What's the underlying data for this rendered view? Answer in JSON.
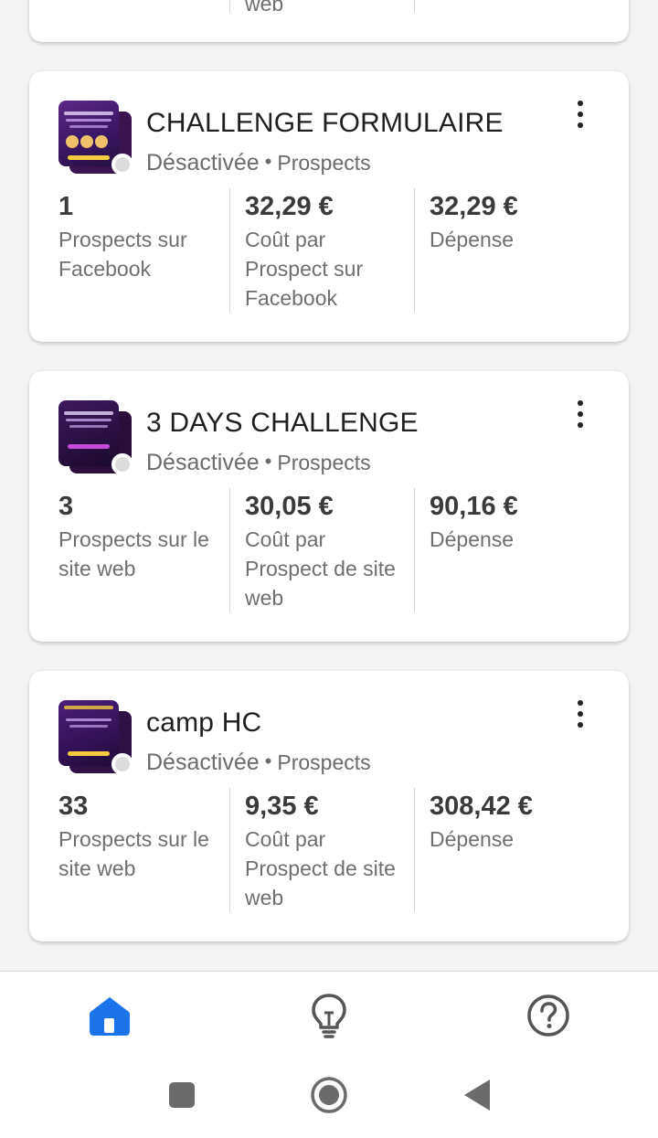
{
  "previous_card": {
    "partial_label": "web"
  },
  "campaigns": [
    {
      "name": "CHALLENGE FORMULAIRE",
      "status": "Désactivée",
      "separator": "•",
      "objective": "Prospects",
      "metrics": [
        {
          "value": "1",
          "label_lines": [
            "Prospects sur",
            "Facebook"
          ]
        },
        {
          "value": "32,29 €",
          "label_lines": [
            "Coût par",
            "Prospect sur",
            "Facebook"
          ]
        },
        {
          "value": "32,29 €",
          "label_lines": [
            "Dépense"
          ]
        }
      ]
    },
    {
      "name": "3 DAYS CHALLENGE",
      "status": "Désactivée",
      "separator": "•",
      "objective": "Prospects",
      "metrics": [
        {
          "value": "3",
          "label_lines": [
            "Prospects sur le",
            "site web"
          ]
        },
        {
          "value": "30,05 €",
          "label_lines": [
            "Coût par",
            "Prospect de site",
            "web"
          ]
        },
        {
          "value": "90,16 €",
          "label_lines": [
            "Dépense"
          ]
        }
      ]
    },
    {
      "name": "camp HC",
      "status": "Désactivée",
      "separator": "•",
      "objective": "Prospects",
      "metrics": [
        {
          "value": "33",
          "label_lines": [
            "Prospects sur le",
            "site web"
          ]
        },
        {
          "value": "9,35 €",
          "label_lines": [
            "Coût par",
            "Prospect de site",
            "web"
          ]
        },
        {
          "value": "308,42 €",
          "label_lines": [
            "Dépense"
          ]
        }
      ]
    }
  ],
  "bottom_nav": {
    "items": [
      {
        "icon": "home-icon",
        "active": true
      },
      {
        "icon": "lightbulb-icon",
        "active": false
      },
      {
        "icon": "help-icon",
        "active": false
      }
    ],
    "active_color": "#1a73e8",
    "inactive_color": "#555555"
  },
  "system_nav": [
    "recents-icon",
    "home-circle-icon",
    "back-icon"
  ]
}
